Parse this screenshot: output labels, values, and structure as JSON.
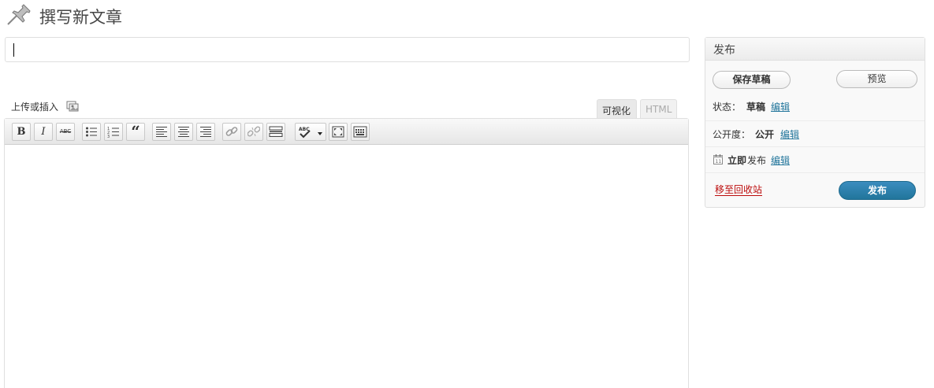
{
  "header": {
    "title": "撰写新文章",
    "icon": "pushpin-icon"
  },
  "title_field": {
    "value": "",
    "placeholder": ""
  },
  "media": {
    "label": "上传或插入",
    "icon": "upload-media-icon"
  },
  "editor_tabs": [
    {
      "label": "可视化",
      "active": true
    },
    {
      "label": "HTML",
      "active": false
    }
  ],
  "toolbar": {
    "bold": "B",
    "italic": "I",
    "strike": "ABC",
    "quote": "“",
    "buttons": [
      "bold-icon",
      "italic-icon",
      "strikethrough-icon",
      "bullet-list-icon",
      "numbered-list-icon",
      "blockquote-icon",
      "align-left-icon",
      "align-center-icon",
      "align-right-icon",
      "link-icon",
      "unlink-icon",
      "more-tag-icon",
      "spellcheck-icon",
      "fullscreen-icon",
      "kitchen-sink-icon"
    ]
  },
  "publish": {
    "title": "发布",
    "save_draft": "保存草稿",
    "preview": "预览",
    "status_label": "状态：",
    "status_value": "草稿",
    "visibility_label": "公开度：",
    "visibility_value": "公开",
    "schedule_bold": "立即",
    "schedule_text": "发布",
    "edit": "编辑",
    "trash": "移至回收站",
    "publish_button": "发布",
    "colors": {
      "primary": "#21759b",
      "danger": "#bc0b0b"
    }
  }
}
